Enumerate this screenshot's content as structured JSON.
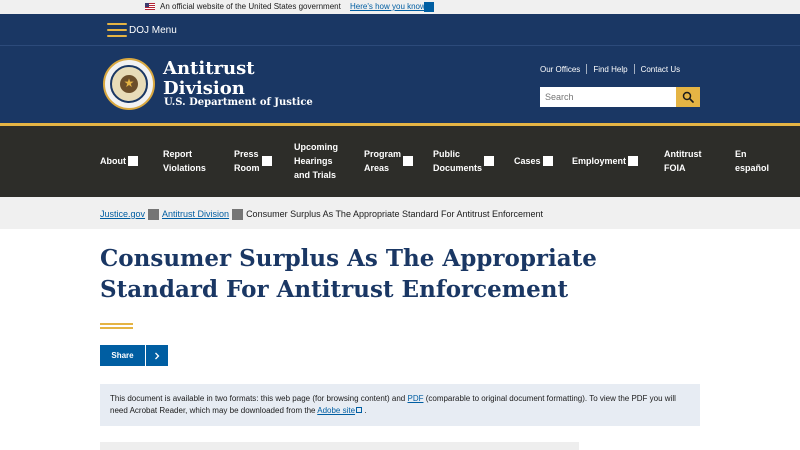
{
  "gov_banner": {
    "text": "An official website of the United States government",
    "link": "Here's how you know",
    "flag_icon": "us-flag-icon",
    "toggle_icon": "chevron-down-icon"
  },
  "header": {
    "menu_label": "DOJ Menu",
    "menu_icon": "hamburger-icon",
    "brand_line1": "Antitrust",
    "brand_line2": "Division",
    "brand_line3": "U.S. Department of Justice",
    "seal_icon": "doj-seal-icon",
    "utility_links": [
      "Our Offices",
      "Find Help",
      "Contact Us"
    ],
    "search_placeholder": "Search",
    "search_icon": "search-icon"
  },
  "nav": {
    "items": [
      {
        "label": "About",
        "dropdown": true
      },
      {
        "label": "Report\nViolations",
        "dropdown": false
      },
      {
        "label": "Press\nRoom",
        "dropdown": true
      },
      {
        "label": "Upcoming\nHearings\nand Trials",
        "dropdown": false
      },
      {
        "label": "Program\nAreas",
        "dropdown": true
      },
      {
        "label": "Public\nDocuments",
        "dropdown": true
      },
      {
        "label": "Cases",
        "dropdown": true
      },
      {
        "label": "Employment",
        "dropdown": true
      },
      {
        "label": "Antitrust\nFOIA",
        "dropdown": false
      },
      {
        "label": "En\nespañol",
        "dropdown": false
      }
    ]
  },
  "breadcrumb": {
    "items": [
      "Justice.gov",
      "Antitrust Division"
    ],
    "current": "Consumer Surplus As The Appropriate Standard For Antitrust Enforcement"
  },
  "page": {
    "title": "Consumer Surplus As The Appropriate Standard For Antitrust Enforcement",
    "share_label": "Share",
    "share_icon": "chevron-right-icon",
    "notice_before_pdf": "This document is available in two formats: this web page (for browsing content) and ",
    "notice_pdf_link": "PDF",
    "notice_after_pdf": " (comparable to original document formatting). To view the PDF you will need Acrobat Reader, which may be downloaded from the ",
    "notice_adobe_link": "Adobe site",
    "notice_end": " .",
    "external_icon": "external-link-icon"
  },
  "colors": {
    "header_blue": "#1a3764",
    "gold": "#e5b444",
    "nav_dark": "#2d2d29",
    "link_blue": "#005ea2"
  }
}
